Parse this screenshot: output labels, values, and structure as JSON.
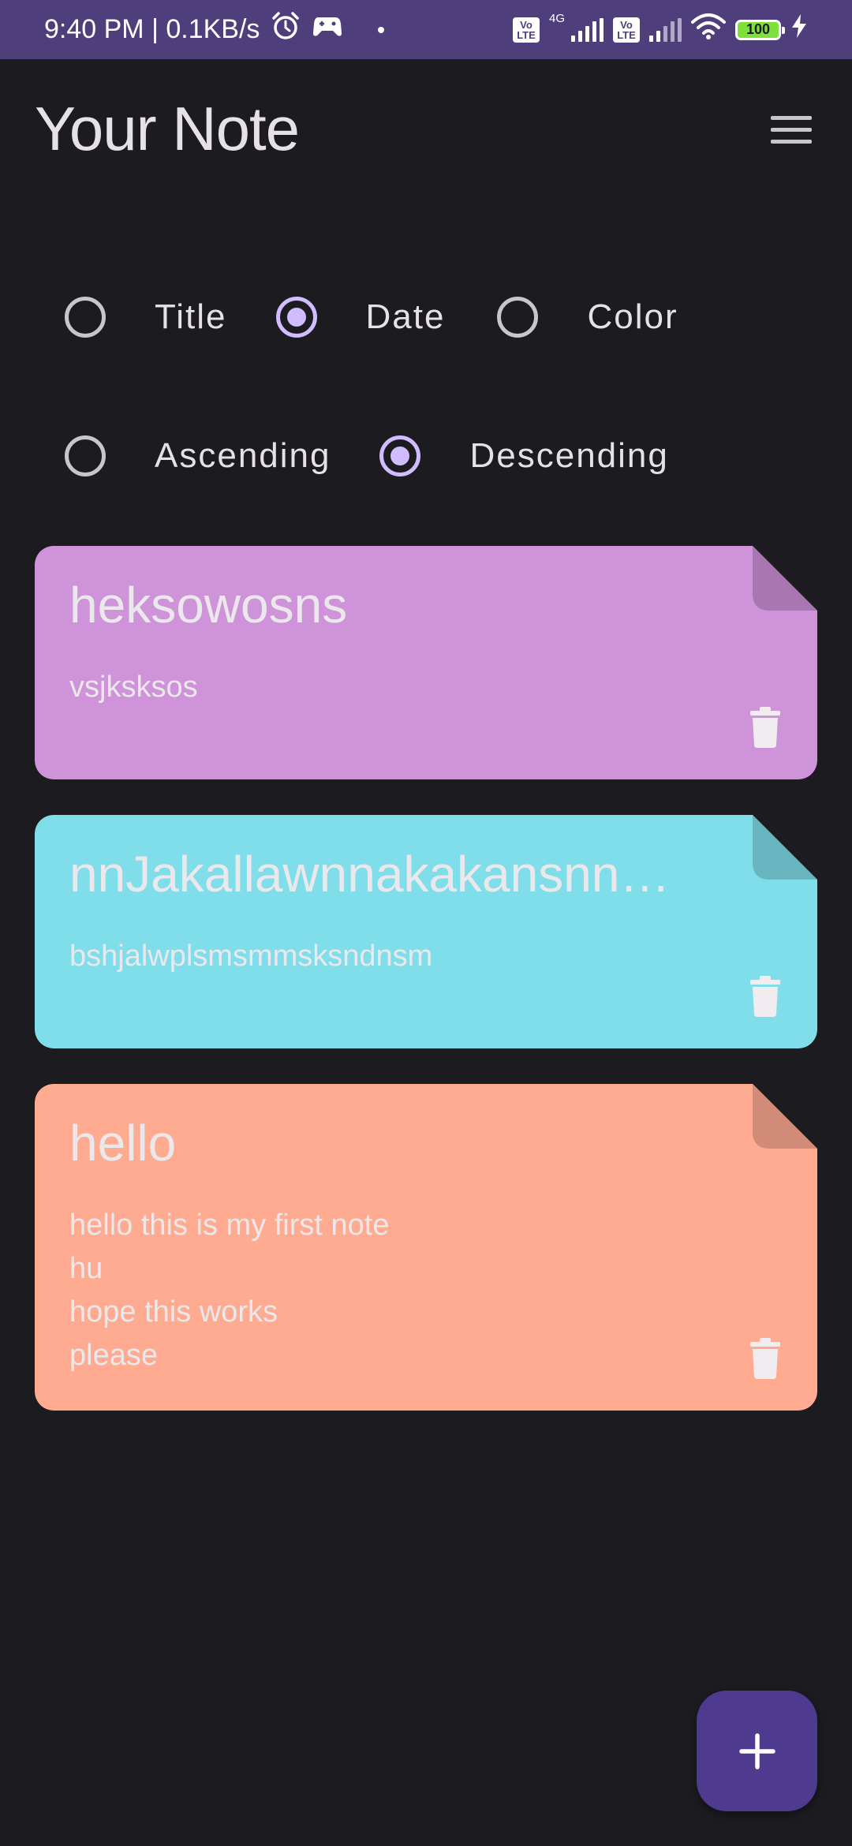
{
  "status_bar": {
    "time_speed": "9:40 PM | 0.1KB/s",
    "volte_label": "Vo LTE",
    "network_label": "4G",
    "battery_level": "100"
  },
  "header": {
    "title": "Your Note"
  },
  "sort": {
    "field_options": [
      {
        "label": "Title",
        "checked": false
      },
      {
        "label": "Date",
        "checked": true
      },
      {
        "label": "Color",
        "checked": false
      }
    ],
    "order_options": [
      {
        "label": "Ascending",
        "checked": false
      },
      {
        "label": "Descending",
        "checked": true
      }
    ]
  },
  "notes": [
    {
      "title": "heksowosns",
      "content": "vsjksksos",
      "color": "#cf93d9",
      "fold_color": "#a876b1"
    },
    {
      "title": "nnJakallawnnakakansnn…",
      "content": "bshjalwplsmsmmsksndnsm",
      "color": "#80deea",
      "fold_color": "#68b5bf"
    },
    {
      "title": "hello",
      "content": "hello this is my first note\nhu\nhope this works\nplease",
      "color": "#ffab91",
      "fold_color": "#d08c77"
    }
  ],
  "icons": {
    "menu": "menu-icon",
    "delete": "delete-icon",
    "add": "plus-icon",
    "alarm": "alarm-icon",
    "wifi": "wifi-icon",
    "charging": "charging-icon"
  },
  "colors": {
    "background": "#1c1b1f",
    "status_bar": "#4e3f7c",
    "radio_accent": "#d0bcff",
    "fab": "#4e3a8e"
  }
}
